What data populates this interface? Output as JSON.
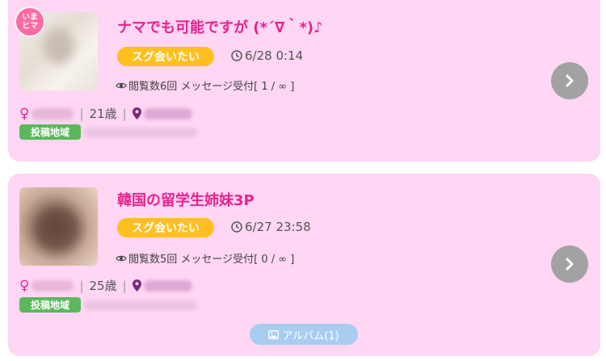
{
  "posts": [
    {
      "badge": "いまヒマ",
      "title": "ナマでも可能ですが (*´∇｀*)♪",
      "tag": "スグ会いたい",
      "time": "6/28 0:14",
      "views": "閲覧数6回 メッセージ受付[ 1 / ∞ ]",
      "gender_symbol": "♀",
      "age": "21歳",
      "region_label": "投稿地域"
    },
    {
      "title": "韓国の留学生姉妹3P",
      "tag": "スグ会いたい",
      "time": "6/27 23:58",
      "views": "閲覧数5回 メッセージ受付[ 0 / ∞ ]",
      "gender_symbol": "♀",
      "age": "25歳",
      "region_label": "投稿地域",
      "album": "アルバム(1)"
    }
  ],
  "colors": {
    "card_bg": "#ffd6f3",
    "title": "#e4238f",
    "tag_bg": "#ffbf1f",
    "region_tag_bg": "#5cb85c",
    "arrow_bg": "#a2a2a2",
    "album_bg": "#a9ccf1"
  },
  "icons": [
    "clock-icon",
    "eye-icon",
    "location-pin-icon",
    "chevron-right-icon",
    "image-icon"
  ]
}
